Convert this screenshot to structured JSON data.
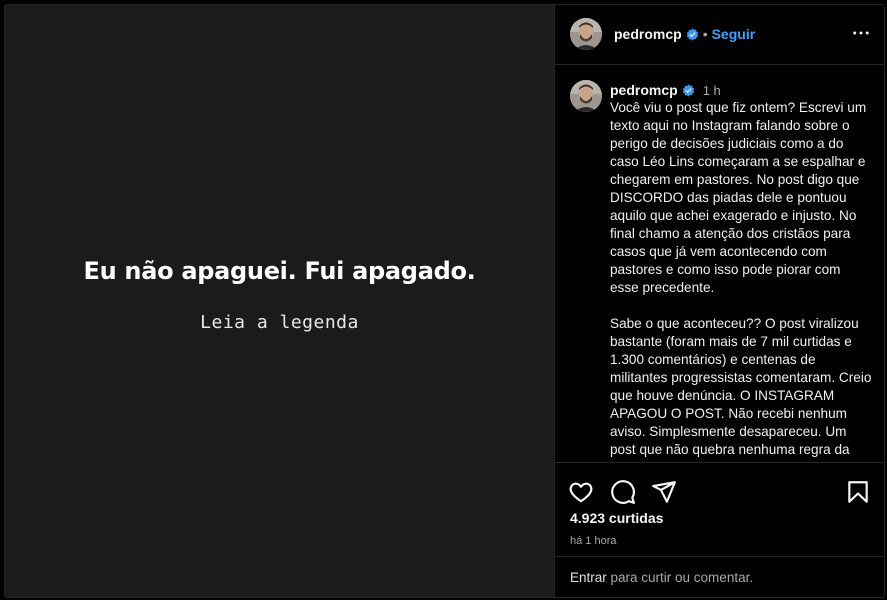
{
  "media": {
    "headline": "Eu não apaguei. Fui apagado.",
    "subtitle": "Leia a legenda"
  },
  "header": {
    "username": "pedromcp",
    "separator": "•",
    "follow_label": "Seguir",
    "verified_icon": "verified-badge-icon",
    "more_icon": "more-options-icon"
  },
  "caption": {
    "username": "pedromcp",
    "time": "1 h",
    "text": "Você viu o post que fiz ontem? Escrevi um texto aqui no Instagram falando sobre o perigo de decisões judiciais como a do caso Léo Lins começaram a se espalhar e chegarem em pastores. No post digo que DISCORDO das piadas dele e pontuou aquilo que achei exagerado e injusto. No final chamo a atenção dos cristãos para casos que já vem acontecendo com pastores e como isso pode piorar com esse precedente.\n\nSabe o que aconteceu?? O post viralizou bastante (foram mais de 7 mil curtidas e 1.300 comentários) e centenas de militantes progressistas comentaram. Creio que houve denúncia. O INSTAGRAM APAGOU O POST. Não recebi nenhum aviso. Simplesmente desapareceu. Um post que não quebra nenhuma regra da plataforma não há"
  },
  "actions": {
    "likes": "4.923 curtidas",
    "ago": "há 1 hora",
    "icons": [
      "heart-icon",
      "comment-icon",
      "share-icon",
      "bookmark-icon"
    ]
  },
  "login": {
    "link_label": "Entrar",
    "rest": " para curtir ou comentar."
  },
  "colors": {
    "accent": "#4a9df8",
    "verified": "#3897f0",
    "background": "#000000",
    "media_background": "#1b1b1b"
  }
}
